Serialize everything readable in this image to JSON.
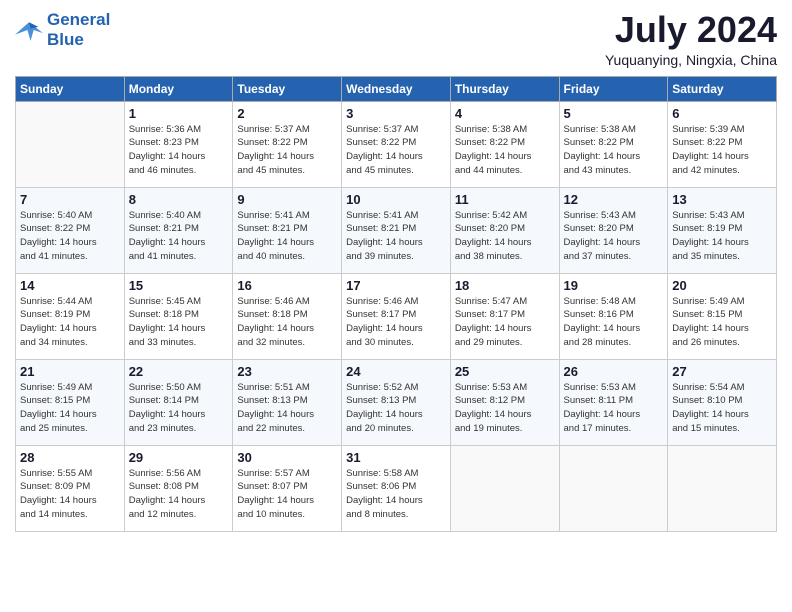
{
  "header": {
    "logo_line1": "General",
    "logo_line2": "Blue",
    "month_year": "July 2024",
    "location": "Yuquanying, Ningxia, China"
  },
  "weekdays": [
    "Sunday",
    "Monday",
    "Tuesday",
    "Wednesday",
    "Thursday",
    "Friday",
    "Saturday"
  ],
  "weeks": [
    [
      {
        "day": "",
        "info": ""
      },
      {
        "day": "1",
        "info": "Sunrise: 5:36 AM\nSunset: 8:23 PM\nDaylight: 14 hours\nand 46 minutes."
      },
      {
        "day": "2",
        "info": "Sunrise: 5:37 AM\nSunset: 8:22 PM\nDaylight: 14 hours\nand 45 minutes."
      },
      {
        "day": "3",
        "info": "Sunrise: 5:37 AM\nSunset: 8:22 PM\nDaylight: 14 hours\nand 45 minutes."
      },
      {
        "day": "4",
        "info": "Sunrise: 5:38 AM\nSunset: 8:22 PM\nDaylight: 14 hours\nand 44 minutes."
      },
      {
        "day": "5",
        "info": "Sunrise: 5:38 AM\nSunset: 8:22 PM\nDaylight: 14 hours\nand 43 minutes."
      },
      {
        "day": "6",
        "info": "Sunrise: 5:39 AM\nSunset: 8:22 PM\nDaylight: 14 hours\nand 42 minutes."
      }
    ],
    [
      {
        "day": "7",
        "info": "Sunrise: 5:40 AM\nSunset: 8:22 PM\nDaylight: 14 hours\nand 41 minutes."
      },
      {
        "day": "8",
        "info": "Sunrise: 5:40 AM\nSunset: 8:21 PM\nDaylight: 14 hours\nand 41 minutes."
      },
      {
        "day": "9",
        "info": "Sunrise: 5:41 AM\nSunset: 8:21 PM\nDaylight: 14 hours\nand 40 minutes."
      },
      {
        "day": "10",
        "info": "Sunrise: 5:41 AM\nSunset: 8:21 PM\nDaylight: 14 hours\nand 39 minutes."
      },
      {
        "day": "11",
        "info": "Sunrise: 5:42 AM\nSunset: 8:20 PM\nDaylight: 14 hours\nand 38 minutes."
      },
      {
        "day": "12",
        "info": "Sunrise: 5:43 AM\nSunset: 8:20 PM\nDaylight: 14 hours\nand 37 minutes."
      },
      {
        "day": "13",
        "info": "Sunrise: 5:43 AM\nSunset: 8:19 PM\nDaylight: 14 hours\nand 35 minutes."
      }
    ],
    [
      {
        "day": "14",
        "info": "Sunrise: 5:44 AM\nSunset: 8:19 PM\nDaylight: 14 hours\nand 34 minutes."
      },
      {
        "day": "15",
        "info": "Sunrise: 5:45 AM\nSunset: 8:18 PM\nDaylight: 14 hours\nand 33 minutes."
      },
      {
        "day": "16",
        "info": "Sunrise: 5:46 AM\nSunset: 8:18 PM\nDaylight: 14 hours\nand 32 minutes."
      },
      {
        "day": "17",
        "info": "Sunrise: 5:46 AM\nSunset: 8:17 PM\nDaylight: 14 hours\nand 30 minutes."
      },
      {
        "day": "18",
        "info": "Sunrise: 5:47 AM\nSunset: 8:17 PM\nDaylight: 14 hours\nand 29 minutes."
      },
      {
        "day": "19",
        "info": "Sunrise: 5:48 AM\nSunset: 8:16 PM\nDaylight: 14 hours\nand 28 minutes."
      },
      {
        "day": "20",
        "info": "Sunrise: 5:49 AM\nSunset: 8:15 PM\nDaylight: 14 hours\nand 26 minutes."
      }
    ],
    [
      {
        "day": "21",
        "info": "Sunrise: 5:49 AM\nSunset: 8:15 PM\nDaylight: 14 hours\nand 25 minutes."
      },
      {
        "day": "22",
        "info": "Sunrise: 5:50 AM\nSunset: 8:14 PM\nDaylight: 14 hours\nand 23 minutes."
      },
      {
        "day": "23",
        "info": "Sunrise: 5:51 AM\nSunset: 8:13 PM\nDaylight: 14 hours\nand 22 minutes."
      },
      {
        "day": "24",
        "info": "Sunrise: 5:52 AM\nSunset: 8:13 PM\nDaylight: 14 hours\nand 20 minutes."
      },
      {
        "day": "25",
        "info": "Sunrise: 5:53 AM\nSunset: 8:12 PM\nDaylight: 14 hours\nand 19 minutes."
      },
      {
        "day": "26",
        "info": "Sunrise: 5:53 AM\nSunset: 8:11 PM\nDaylight: 14 hours\nand 17 minutes."
      },
      {
        "day": "27",
        "info": "Sunrise: 5:54 AM\nSunset: 8:10 PM\nDaylight: 14 hours\nand 15 minutes."
      }
    ],
    [
      {
        "day": "28",
        "info": "Sunrise: 5:55 AM\nSunset: 8:09 PM\nDaylight: 14 hours\nand 14 minutes."
      },
      {
        "day": "29",
        "info": "Sunrise: 5:56 AM\nSunset: 8:08 PM\nDaylight: 14 hours\nand 12 minutes."
      },
      {
        "day": "30",
        "info": "Sunrise: 5:57 AM\nSunset: 8:07 PM\nDaylight: 14 hours\nand 10 minutes."
      },
      {
        "day": "31",
        "info": "Sunrise: 5:58 AM\nSunset: 8:06 PM\nDaylight: 14 hours\nand 8 minutes."
      },
      {
        "day": "",
        "info": ""
      },
      {
        "day": "",
        "info": ""
      },
      {
        "day": "",
        "info": ""
      }
    ]
  ]
}
